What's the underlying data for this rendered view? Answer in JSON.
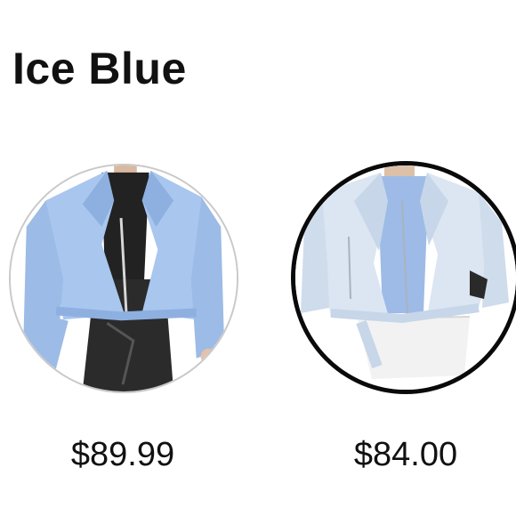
{
  "color_selector": {
    "selected_color_name": "Ice Blue",
    "options": [
      {
        "price": "$89.99",
        "image_icon": "blue-moto-jacket-thumbnail",
        "jacket_color": "#a9c6ee",
        "top_color": "#222222",
        "bottom_color": "#2b2b2b",
        "selected": false
      },
      {
        "price": "$84.00",
        "image_icon": "ice-blue-moto-jacket-thumbnail",
        "jacket_color": "#dce6f2",
        "top_color": "#9dbbe6",
        "bottom_color": "#f2f2f2",
        "selected": true
      }
    ],
    "selected_border_color": "#0a0a0a",
    "unselected_border_color": "#c9c9c9"
  }
}
